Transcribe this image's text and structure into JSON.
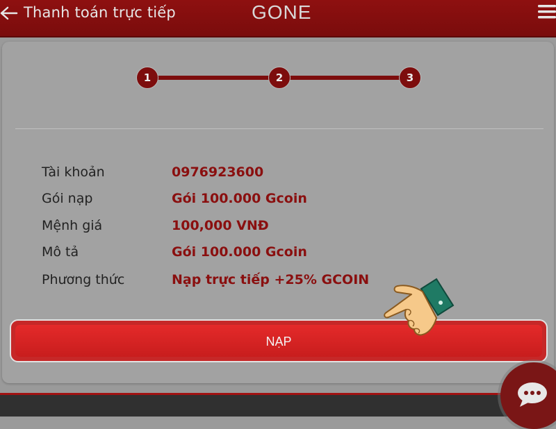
{
  "header": {
    "title": "Thanh toán trực tiếp",
    "logo_text": "GONE",
    "back_icon": "arrow-left-icon",
    "menu_icon": "hamburger-menu-icon"
  },
  "stepper": {
    "steps": [
      "1",
      "2",
      "3"
    ],
    "current_step": 3
  },
  "details": [
    {
      "label": "Tài khoản",
      "value": "0976923600"
    },
    {
      "label": "Gói nạp",
      "value": "Gói 100.000 Gcoin"
    },
    {
      "label": "Mệnh giá",
      "value": "100,000 VNĐ"
    },
    {
      "label": "Mô tả",
      "value": "Gói 100.000 Gcoin"
    },
    {
      "label": "Phương thức",
      "value": "Nạp trực tiếp +25% GCOIN"
    }
  ],
  "actions": {
    "submit_label": "NẠP"
  },
  "icons": {
    "pointer": "pointing-hand-icon",
    "chat": "chat-bubble-icon"
  },
  "colors": {
    "brand_red": "#8e1010",
    "accent_red": "#d42020",
    "value_text": "#8a0f0f"
  }
}
